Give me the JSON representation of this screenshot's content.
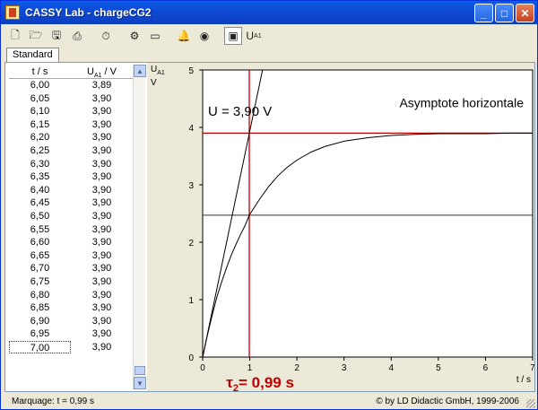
{
  "window": {
    "title": "CASSY Lab - chargeCG2"
  },
  "toolbar": {
    "icons": [
      "new-icon",
      "open-icon",
      "save-icon",
      "print-icon",
      "timer-icon",
      "settings-icon",
      "display-icon",
      "bell-icon",
      "stop-icon",
      "window-icon",
      "ua1-icon"
    ],
    "ua1_label": "U",
    "ua1_sub": "A1"
  },
  "tabs": [
    {
      "label": "Standard"
    }
  ],
  "table": {
    "headers": [
      "t / s",
      "U",
      "A1",
      " / V"
    ],
    "rows": [
      [
        "6,00",
        "3,89"
      ],
      [
        "6,05",
        "3,90"
      ],
      [
        "6,10",
        "3,90"
      ],
      [
        "6,15",
        "3,90"
      ],
      [
        "6,20",
        "3,90"
      ],
      [
        "6,25",
        "3,90"
      ],
      [
        "6,30",
        "3,90"
      ],
      [
        "6,35",
        "3,90"
      ],
      [
        "6,40",
        "3,90"
      ],
      [
        "6,45",
        "3,90"
      ],
      [
        "6,50",
        "3,90"
      ],
      [
        "6,55",
        "3,90"
      ],
      [
        "6,60",
        "3,90"
      ],
      [
        "6,65",
        "3,90"
      ],
      [
        "6,70",
        "3,90"
      ],
      [
        "6,75",
        "3,90"
      ],
      [
        "6,80",
        "3,90"
      ],
      [
        "6,85",
        "3,90"
      ],
      [
        "6,90",
        "3,90"
      ],
      [
        "6,95",
        "3,90"
      ],
      [
        "7,00",
        "3,90"
      ]
    ]
  },
  "chart_data": {
    "type": "line",
    "ylabel_top": "U",
    "ylabel_sub": "A1",
    "ylabel_unit": "V",
    "xlabel": "t / s",
    "xlim": [
      0,
      7
    ],
    "ylim": [
      0,
      5
    ],
    "xticks": [
      0,
      1,
      2,
      3,
      4,
      5,
      6,
      7
    ],
    "yticks": [
      0,
      1,
      2,
      3,
      4,
      5
    ],
    "series": [
      {
        "x": [
          0,
          0.1,
          0.2,
          0.3,
          0.4,
          0.5,
          0.6,
          0.7,
          0.8,
          0.9,
          0.99,
          1.2,
          1.4,
          1.6,
          1.8,
          2.0,
          2.3,
          2.6,
          3.0,
          3.5,
          4.0,
          4.5,
          5.0,
          5.5,
          6.0,
          6.5,
          7.0
        ],
        "y": [
          0,
          0.38,
          0.72,
          1.04,
          1.3,
          1.54,
          1.76,
          1.95,
          2.13,
          2.29,
          2.47,
          2.74,
          2.97,
          3.16,
          3.31,
          3.43,
          3.57,
          3.67,
          3.76,
          3.82,
          3.86,
          3.88,
          3.89,
          3.89,
          3.89,
          3.9,
          3.9
        ]
      }
    ],
    "tangent": {
      "x": [
        0,
        1.27
      ],
      "y": [
        0,
        5
      ]
    },
    "hline_asymptote": 3.9,
    "hline_half": 2.47,
    "vline_tau": 0.99,
    "annotations": {
      "voltage": "U = 3,90 V",
      "asymptote": "Asymptote horizontale",
      "tau_symbol": "τ",
      "tau_sub": "2",
      "tau_value": "= 0,99 s"
    }
  },
  "status": {
    "marker": "Marquage:  t = 0,99 s",
    "copyright": "© by LD Didactic GmbH, 1999-2006"
  }
}
